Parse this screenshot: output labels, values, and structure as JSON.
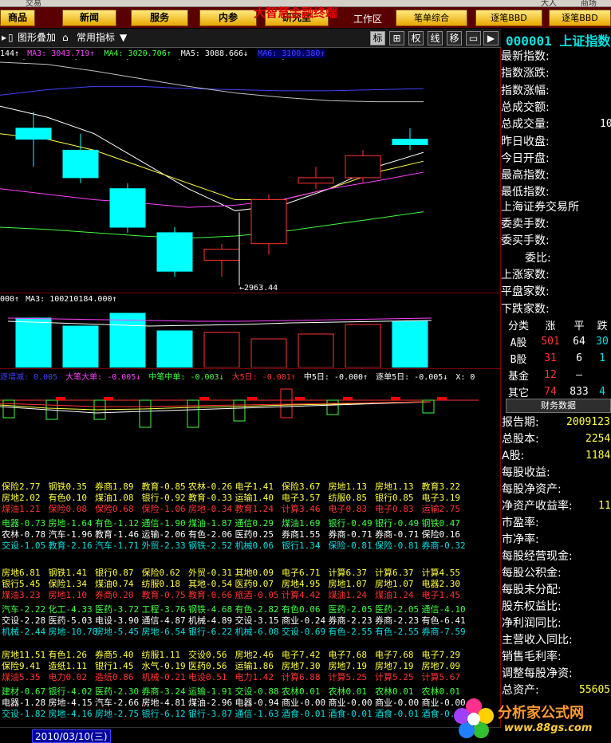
{
  "top_bar": {
    "left_text": "交易",
    "right_a": "大人",
    "right_b": "商场"
  },
  "menu": {
    "items": [
      "商品",
      "新闻",
      "服务",
      "内参",
      "研究室"
    ],
    "app_name": "大智慧金融终端",
    "work_area": "工作区",
    "right_buttons": [
      "笔单综合",
      "逐笔BBD",
      "逐笔BBD"
    ]
  },
  "toolbar": {
    "overlay_label": "图形叠加",
    "indicator_label": "常用指标",
    "right_tabs": [
      "标",
      "⊞",
      "权",
      "线",
      "移",
      "▭",
      "▶"
    ]
  },
  "ma_bar": {
    "m1": "144↑",
    "ma3": "MA3: 3043.719↑",
    "ma4": "MA4: 3020.706↑",
    "ma5": "MA5: 3088.666↓",
    "ma6": "MA6: 3100.380↑"
  },
  "kline": {
    "low_label": "←2963.44",
    "candles": [
      {
        "o": 3040,
        "c": 3030,
        "h": 3055,
        "l": 3005
      },
      {
        "o": 3020,
        "c": 2995,
        "h": 3035,
        "l": 2990
      },
      {
        "o": 2985,
        "c": 2950,
        "h": 2990,
        "l": 2945
      },
      {
        "o": 2945,
        "c": 2910,
        "h": 2950,
        "l": 2905
      },
      {
        "o": 2920,
        "c": 2930,
        "h": 2935,
        "l": 2905
      },
      {
        "o": 2935,
        "c": 2975,
        "h": 2980,
        "l": 2925
      },
      {
        "o": 2990,
        "c": 2995,
        "h": 3005,
        "l": 2985
      },
      {
        "o": 2995,
        "c": 3015,
        "h": 3020,
        "l": 2990
      },
      {
        "o": 3030,
        "c": 3025,
        "h": 3040,
        "l": 3020
      }
    ]
  },
  "volume_bar": {
    "v1": "000↑",
    "ma3": "MA3: 100210184.000↑"
  },
  "bbd_bar": {
    "t0": "逐增减: 0.005",
    "t1": "大笔大单: -0.005↓",
    "t2": "中笔中单: -0.003↓",
    "t3": "大5日: -0.001↑",
    "t4": "中5日: -0.000↑",
    "t5": "逐单5日: -0.005↓",
    "t6": "X: 0"
  },
  "quote": {
    "code": "000001 上证指数",
    "labels": [
      "最新指数:",
      "指数涨跌:",
      "指数涨幅:",
      "总成交额:",
      "总成交量:",
      "昨日收盘:",
      "今日开盘:",
      "最高指数:",
      "最低指数:"
    ],
    "values": [
      "",
      "",
      "",
      "",
      "10",
      "",
      "",
      "",
      ""
    ],
    "exchange": "上海证券交易所",
    "labels2": [
      "委卖手数:",
      "委买手数:",
      "委比:",
      "上涨家数:",
      "平盘家数:",
      "下跌家数:"
    ]
  },
  "stats": {
    "header": [
      "分类",
      "涨",
      "平",
      "跌"
    ],
    "rows": [
      {
        "name": "A股",
        "up": "501",
        "flat": "64",
        "down": "30"
      },
      {
        "name": "B股",
        "up": "31",
        "flat": "6",
        "down": "1"
      },
      {
        "name": "基金",
        "up": "12",
        "flat": "–",
        "down": ""
      },
      {
        "name": "其它",
        "up": "74",
        "flat": "833",
        "down": "4"
      }
    ]
  },
  "finance": {
    "tab": "财务数据",
    "rows": [
      {
        "label": "报告期:",
        "value": "2009123"
      },
      {
        "label": "总股本:",
        "value": "2254"
      },
      {
        "label": "A股:",
        "value": "1184"
      },
      {
        "label": "每股收益:",
        "value": ""
      },
      {
        "label": "每股净资产:",
        "value": ""
      },
      {
        "label": "净资产收益率:",
        "value": "11"
      },
      {
        "label": "市盈率:",
        "value": ""
      },
      {
        "label": "市净率:",
        "value": ""
      },
      {
        "label": "每股经营现金:",
        "value": ""
      },
      {
        "label": "每股公积金:",
        "value": ""
      },
      {
        "label": "每股未分配:",
        "value": ""
      },
      {
        "label": "股东权益比:",
        "value": ""
      },
      {
        "label": "净利润同比:",
        "value": ""
      },
      {
        "label": "主营收入同比:",
        "value": ""
      },
      {
        "label": "销售毛利率:",
        "value": ""
      },
      {
        "label": "调整每股净资:",
        "value": ""
      },
      {
        "label": "总资产:",
        "value": "55605"
      }
    ]
  },
  "sectors": [
    [
      [
        [
          "保险2.77",
          "y"
        ],
        [
          "钢铁0.35",
          "y"
        ],
        [
          "券商1.89",
          "y"
        ],
        [
          "教育-0.85",
          "y"
        ],
        [
          "农林-0.26",
          "y"
        ],
        [
          "电子1.41",
          "y"
        ],
        [
          "保险3.67",
          "y"
        ],
        [
          "房地1.13",
          "y"
        ],
        [
          "房地1.13",
          "y"
        ],
        [
          "教育3.22",
          "y"
        ]
      ],
      [
        [
          "房地2.02",
          "y"
        ],
        [
          "有色0.10",
          "y"
        ],
        [
          "煤油1.08",
          "y"
        ],
        [
          "银行-0.92",
          "y"
        ],
        [
          "教育-0.33",
          "y"
        ],
        [
          "运输1.40",
          "y"
        ],
        [
          "电子3.57",
          "y"
        ],
        [
          "纺服0.85",
          "y"
        ],
        [
          "银行0.85",
          "y"
        ],
        [
          "电子3.19",
          "y"
        ]
      ],
      [
        [
          "煤油1.21",
          "r"
        ],
        [
          "保险0.08",
          "r"
        ],
        [
          "保险0.68",
          "r"
        ],
        [
          "保险-1.06",
          "r"
        ],
        [
          "房地-0.34",
          "r"
        ],
        [
          "教育1.24",
          "r"
        ],
        [
          "计算3.46",
          "r"
        ],
        [
          "电子0.83",
          "r"
        ],
        [
          "电子0.83",
          "r"
        ],
        [
          "运输2.75",
          "r"
        ]
      ],
      [
        [
          "电器-0.73",
          "g"
        ],
        [
          "房地-1.64",
          "g"
        ],
        [
          "有色-1.12",
          "g"
        ],
        [
          "通信-1.90",
          "g"
        ],
        [
          "煤油-1.87",
          "g"
        ],
        [
          "通信0.29",
          "g"
        ],
        [
          "煤油1.69",
          "g"
        ],
        [
          "银行-0.49",
          "g"
        ],
        [
          "银行-0.49",
          "g"
        ],
        [
          "钢铁0.47",
          "g"
        ]
      ],
      [
        [
          "农林-0.78",
          "w"
        ],
        [
          "汽车-1.96",
          "w"
        ],
        [
          "教育-1.46",
          "w"
        ],
        [
          "运输-2.06",
          "w"
        ],
        [
          "有色-2.06",
          "w"
        ],
        [
          "医药0.25",
          "w"
        ],
        [
          "券商1.55",
          "w"
        ],
        [
          "券商-0.71",
          "w"
        ],
        [
          "券商-0.71",
          "w"
        ],
        [
          "保险0.16",
          "w"
        ]
      ],
      [
        [
          "交设-1.05",
          "c"
        ],
        [
          "教育-2.16",
          "c"
        ],
        [
          "汽车-1.71",
          "c"
        ],
        [
          "外贸-2.33",
          "c"
        ],
        [
          "钢铁-2.52",
          "c"
        ],
        [
          "机械0.06",
          "c"
        ],
        [
          "银行1.34",
          "c"
        ],
        [
          "保险-0.81",
          "c"
        ],
        [
          "保险-0.81",
          "c"
        ],
        [
          "券商-0.32",
          "c"
        ]
      ]
    ],
    [
      [
        [
          "房地6.81",
          "y"
        ],
        [
          "钢铁1.41",
          "y"
        ],
        [
          "银行0.87",
          "y"
        ],
        [
          "保险0.62",
          "y"
        ],
        [
          "外贸-0.31",
          "y"
        ],
        [
          "其地0.09",
          "y"
        ],
        [
          "电子6.71",
          "y"
        ],
        [
          "计算6.37",
          "y"
        ],
        [
          "计算6.37",
          "y"
        ],
        [
          "计算4.55",
          "y"
        ]
      ],
      [
        [
          "银行5.45",
          "y"
        ],
        [
          "保险1.34",
          "y"
        ],
        [
          "煤油0.74",
          "y"
        ],
        [
          "纺服0.18",
          "y"
        ],
        [
          "其地-0.54",
          "y"
        ],
        [
          "医药0.07",
          "y"
        ],
        [
          "房地4.95",
          "y"
        ],
        [
          "房地1.07",
          "y"
        ],
        [
          "房地1.07",
          "y"
        ],
        [
          "电器2.30",
          "y"
        ]
      ],
      [
        [
          "煤油3.23",
          "r"
        ],
        [
          "房地1.10",
          "r"
        ],
        [
          "券商0.20",
          "r"
        ],
        [
          "教育-0.75",
          "r"
        ],
        [
          "教育-0.66",
          "r"
        ],
        [
          "旅酒-0.05",
          "r"
        ],
        [
          "计算4.42",
          "r"
        ],
        [
          "煤油1.24",
          "r"
        ],
        [
          "煤油1.24",
          "r"
        ],
        [
          "电子1.45",
          "r"
        ]
      ],
      [
        [
          "汽车-2.22",
          "g"
        ],
        [
          "化工-4.33",
          "g"
        ],
        [
          "医药-3.72",
          "g"
        ],
        [
          "工程-3.76",
          "g"
        ],
        [
          "钢铁-4.68",
          "g"
        ],
        [
          "有色-2.82",
          "g"
        ],
        [
          "有色0.06",
          "g"
        ],
        [
          "医药-2.05",
          "g"
        ],
        [
          "医药-2.05",
          "g"
        ],
        [
          "通信-4.10",
          "g"
        ]
      ],
      [
        [
          "交设-2.28",
          "w"
        ],
        [
          "医药-5.03",
          "w"
        ],
        [
          "电设-3.90",
          "w"
        ],
        [
          "通信-4.87",
          "w"
        ],
        [
          "机械-4.89",
          "w"
        ],
        [
          "交设-3.15",
          "w"
        ],
        [
          "商业-0.24",
          "w"
        ],
        [
          "券商-2.23",
          "w"
        ],
        [
          "券商-2.23",
          "w"
        ],
        [
          "有色-6.41",
          "w"
        ]
      ],
      [
        [
          "机械-2.44",
          "c"
        ],
        [
          "房地-10.78",
          "c"
        ],
        [
          "房地-5.45",
          "c"
        ],
        [
          "房地-6.54",
          "c"
        ],
        [
          "银行-6.22",
          "c"
        ],
        [
          "机械-6.08",
          "c"
        ],
        [
          "交设-0.69",
          "c"
        ],
        [
          "有色-2.55",
          "c"
        ],
        [
          "有色-2.55",
          "c"
        ],
        [
          "券商-7.59",
          "c"
        ]
      ]
    ],
    [
      [
        [
          "房地11.51",
          "y"
        ],
        [
          "有色1.26",
          "y"
        ],
        [
          "券商5.40",
          "y"
        ],
        [
          "纺服1.11",
          "y"
        ],
        [
          "交设0.56",
          "y"
        ],
        [
          "房地2.46",
          "y"
        ],
        [
          "电子7.42",
          "y"
        ],
        [
          "电子7.68",
          "y"
        ],
        [
          "电子7.68",
          "y"
        ],
        [
          "电子7.29",
          "y"
        ]
      ],
      [
        [
          "保险9.41",
          "y"
        ],
        [
          "造纸1.11",
          "y"
        ],
        [
          "银行1.45",
          "y"
        ],
        [
          "水气-0.19",
          "y"
        ],
        [
          "医药0.56",
          "y"
        ],
        [
          "运输1.86",
          "y"
        ],
        [
          "房地7.30",
          "y"
        ],
        [
          "房地7.19",
          "y"
        ],
        [
          "房地7.19",
          "y"
        ],
        [
          "房地7.09",
          "y"
        ]
      ],
      [
        [
          "煤油5.35",
          "r"
        ],
        [
          "电力0.02",
          "r"
        ],
        [
          "造纸0.86",
          "r"
        ],
        [
          "机械-0.21",
          "r"
        ],
        [
          "电设0.51",
          "r"
        ],
        [
          "电力1.42",
          "r"
        ],
        [
          "计算6.88",
          "r"
        ],
        [
          "计算5.25",
          "r"
        ],
        [
          "计算5.25",
          "r"
        ],
        [
          "计算5.67",
          "r"
        ]
      ],
      [
        [
          "建材-0.67",
          "g"
        ],
        [
          "银行-4.02",
          "g"
        ],
        [
          "医药-2.30",
          "g"
        ],
        [
          "券商-3.24",
          "g"
        ],
        [
          "运输-1.91",
          "g"
        ],
        [
          "交设-0.88",
          "g"
        ],
        [
          "农林0.01",
          "g"
        ],
        [
          "农林0.01",
          "g"
        ],
        [
          "农林0.01",
          "g"
        ],
        [
          "农林0.01",
          "g"
        ]
      ],
      [
        [
          "电器-1.28",
          "w"
        ],
        [
          "房地-4.15",
          "w"
        ],
        [
          "汽车-2.66",
          "w"
        ],
        [
          "房地-4.81",
          "w"
        ],
        [
          "煤油-2.96",
          "w"
        ],
        [
          "电器-0.94",
          "w"
        ],
        [
          "商业-0.00",
          "w"
        ],
        [
          "商业-0.00",
          "w"
        ],
        [
          "商业-0.00",
          "w"
        ],
        [
          "商业-0.00",
          "w"
        ]
      ],
      [
        [
          "交设-1.82",
          "c"
        ],
        [
          "房地-4.16",
          "c"
        ],
        [
          "房地-2.75",
          "c"
        ],
        [
          "银行-6.12",
          "c"
        ],
        [
          "银行-3.87",
          "c"
        ],
        [
          "通信-1.63",
          "c"
        ],
        [
          "酒食-0.01",
          "c"
        ],
        [
          "酒食-0.01",
          "c"
        ],
        [
          "酒食-0.01",
          "c"
        ],
        [
          "酒食-0.01",
          "c"
        ]
      ]
    ]
  ],
  "bottom": {
    "date": "2010/03/10(三)"
  },
  "watermark": {
    "name": "分析家公式网",
    "url": "www.88gs.com"
  },
  "colors": {
    "up": "#ff3232",
    "down": "#00ffff",
    "ma_white": "#ffffff",
    "ma_yellow": "#ffff40",
    "ma_magenta": "#ff40ff",
    "ma_green": "#40ff40",
    "ma_blue": "#4040ff"
  }
}
